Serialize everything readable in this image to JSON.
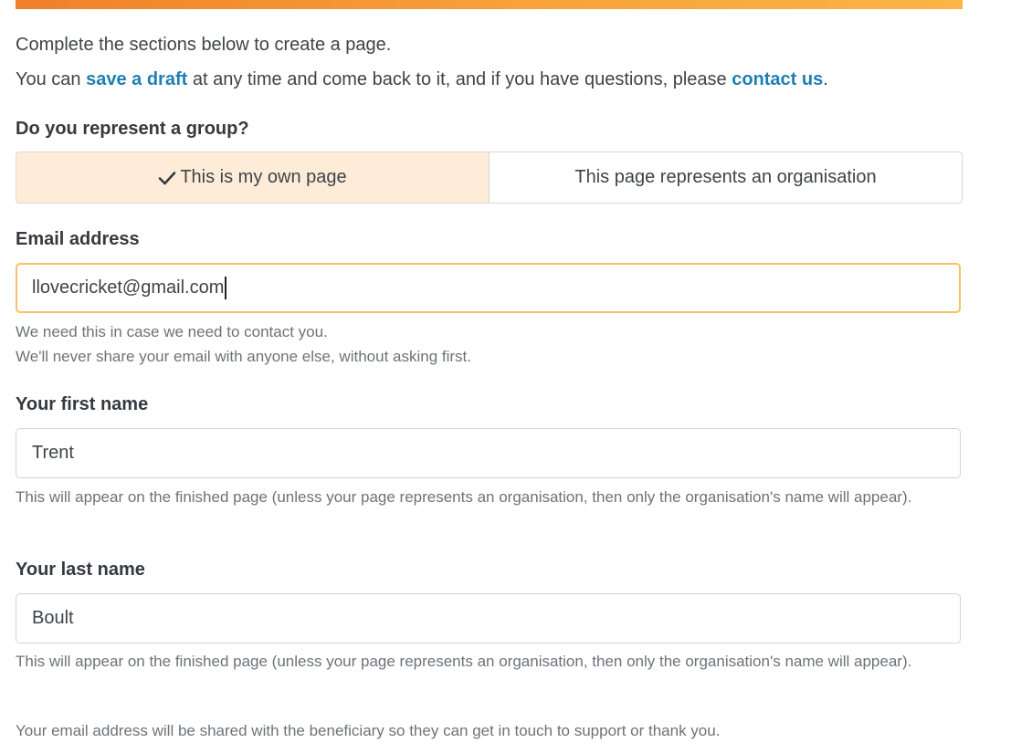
{
  "intro": {
    "line1": "Complete the sections below to create a page.",
    "line2_prefix": "You can ",
    "save_draft_link": "save a draft",
    "line2_middle": " at any time and come back to it, and if you have questions, please ",
    "contact_link": "contact us",
    "line2_suffix": "."
  },
  "group_question": {
    "label": "Do you represent a group?",
    "options": [
      {
        "label": "This is my own page",
        "selected": true,
        "icon": "check-icon"
      },
      {
        "label": "This page represents an organisation",
        "selected": false
      }
    ]
  },
  "email": {
    "label": "Email address",
    "value": "llovecricket@gmail.com",
    "help_line1": "We need this in case we need to contact you.",
    "help_line2": "We'll never share your email with anyone else, without asking first."
  },
  "first_name": {
    "label": "Your first name",
    "value": "Trent",
    "help": "This will appear on the finished page (unless your page represents an organisation, then only the organisation's name will appear)."
  },
  "last_name": {
    "label": "Your last name",
    "value": "Boult",
    "help": "This will appear on the finished page (unless your page represents an organisation, then only the organisation's name will appear)."
  },
  "footer_note": "Your email address will be shared with the beneficiary so they can get in touch to support or thank you.",
  "colors": {
    "accent_bar_start": "#f0802a",
    "accent_bar_end": "#fbb445",
    "link": "#1f7fb2",
    "selected_option_bg": "#feecd8",
    "focus_border": "#f6c266"
  }
}
